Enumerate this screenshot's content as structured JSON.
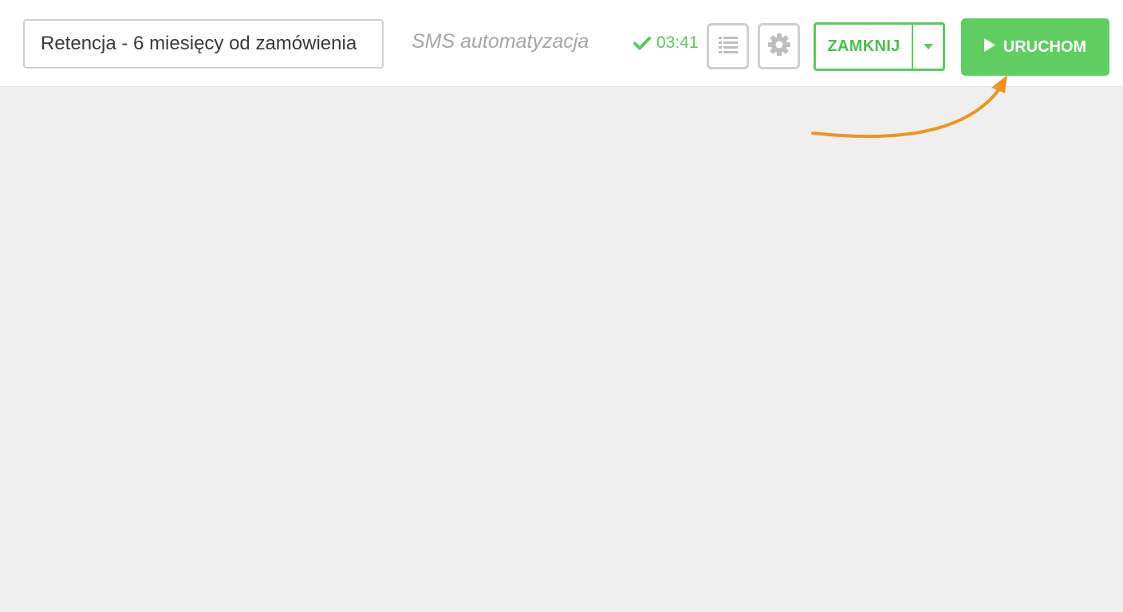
{
  "toolbar": {
    "automation_name": "Retencja - 6 miesięcy od zamówienia",
    "automation_type": "SMS automatyzacja",
    "saved_time": "03:41",
    "close_label": "ZAMKNIJ",
    "run_label": "URUCHOM"
  },
  "icons": {
    "saved": "check-icon",
    "list": "list-icon",
    "settings": "gear-icon",
    "dropdown": "caret-down-icon",
    "run": "play-icon"
  },
  "colors": {
    "accent_green": "#5fcd61",
    "annotation_orange": "#f0931e",
    "muted_grey": "#cfcfcf"
  }
}
